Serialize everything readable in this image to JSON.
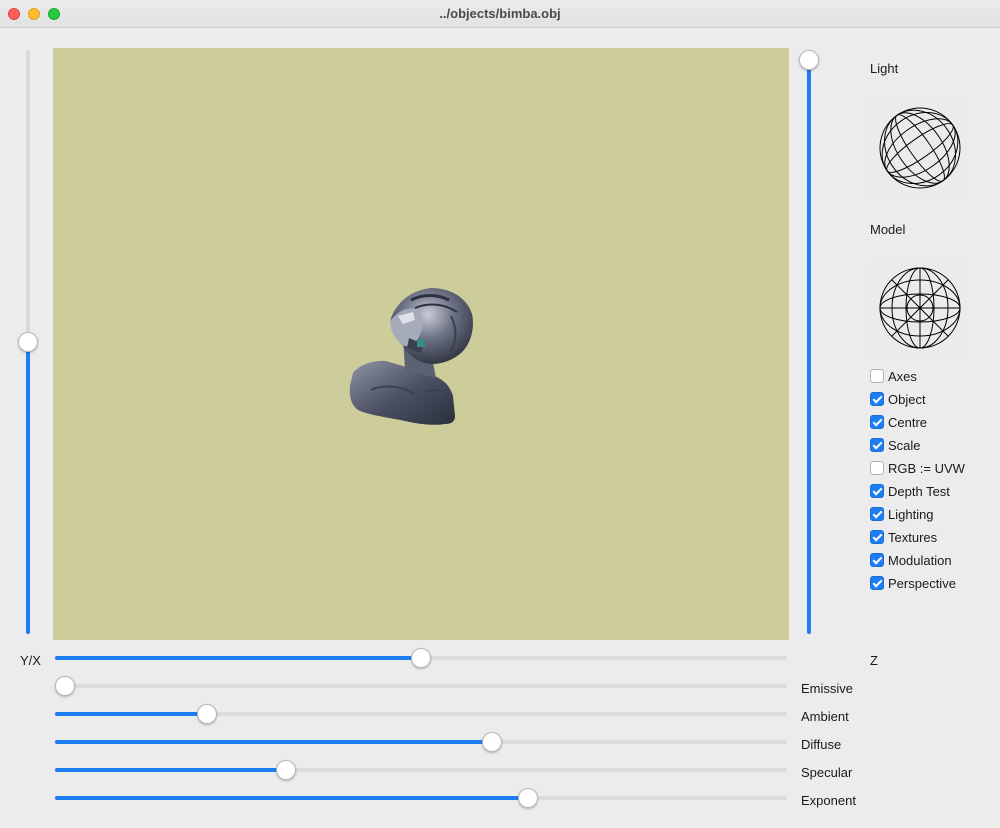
{
  "window": {
    "title": "../objects/bimba.obj"
  },
  "viewport": {
    "background": "#cdcc9b"
  },
  "accent": "#1d7df2",
  "sliders": {
    "left_vertical": {
      "value_fraction": 0.5
    },
    "right_vertical": {
      "value_fraction": 1.0
    },
    "yx": {
      "label": "Y/X",
      "value_fraction": 0.5
    },
    "z": {
      "label": "Z"
    },
    "emissive": {
      "label": "Emissive",
      "value_fraction": 0.0
    },
    "ambient": {
      "label": "Ambient",
      "value_fraction": 0.2
    },
    "diffuse": {
      "label": "Diffuse",
      "value_fraction": 0.6
    },
    "specular": {
      "label": "Specular",
      "value_fraction": 0.31
    },
    "exponent": {
      "label": "Exponent",
      "value_fraction": 0.65
    }
  },
  "panel": {
    "light_label": "Light",
    "model_label": "Model"
  },
  "options": [
    {
      "label": "Axes",
      "checked": false
    },
    {
      "label": "Object",
      "checked": true
    },
    {
      "label": "Centre",
      "checked": true
    },
    {
      "label": "Scale",
      "checked": true
    },
    {
      "label": "RGB := UVW",
      "checked": false
    },
    {
      "label": "Depth Test",
      "checked": true
    },
    {
      "label": "Lighting",
      "checked": true
    },
    {
      "label": "Textures",
      "checked": true
    },
    {
      "label": "Modulation",
      "checked": true
    },
    {
      "label": "Perspective",
      "checked": true
    }
  ]
}
